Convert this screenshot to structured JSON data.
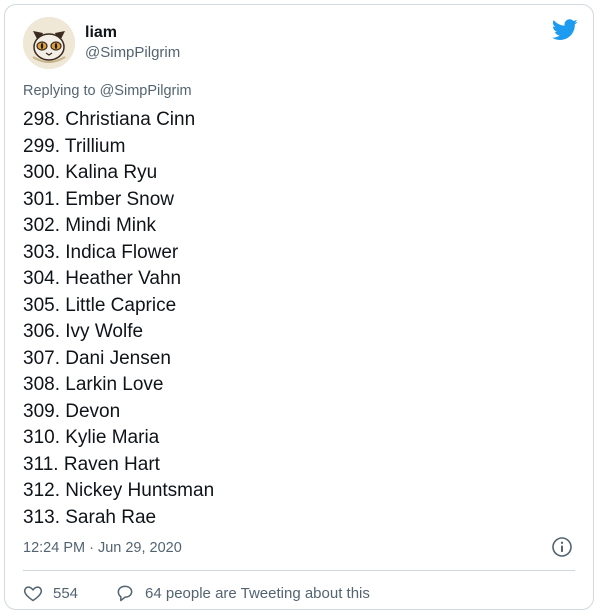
{
  "author": {
    "display_name": "liam",
    "handle": "@SimpPilgrim",
    "avatar_icon": "cat-face-avatar"
  },
  "brand": {
    "logo_icon": "twitter-bird-icon",
    "color": "#1d9bf0"
  },
  "reply": {
    "prefix": "Replying to",
    "mention": "@SimpPilgrim"
  },
  "tweet": {
    "lines": [
      "298. Christiana Cinn",
      "299. Trillium",
      "300. Kalina Ryu",
      "301. Ember Snow",
      "302. Mindi Mink",
      "303. Indica Flower",
      "304. Heather Vahn",
      "305. Little Caprice",
      "306. Ivy Wolfe",
      "307. Dani Jensen",
      "308. Larkin Love",
      "309. Devon",
      "310. Kylie Maria",
      "311. Raven Hart",
      "312. Nickey Huntsman",
      "313. Sarah Rae"
    ]
  },
  "meta": {
    "timestamp": "12:24 PM · Jun 29, 2020",
    "info_icon": "info-icon"
  },
  "actions": {
    "like_count": "554",
    "like_icon": "heart-icon",
    "reply_icon": "speech-bubble-icon",
    "conversation_text": "64 people are Tweeting about this"
  }
}
